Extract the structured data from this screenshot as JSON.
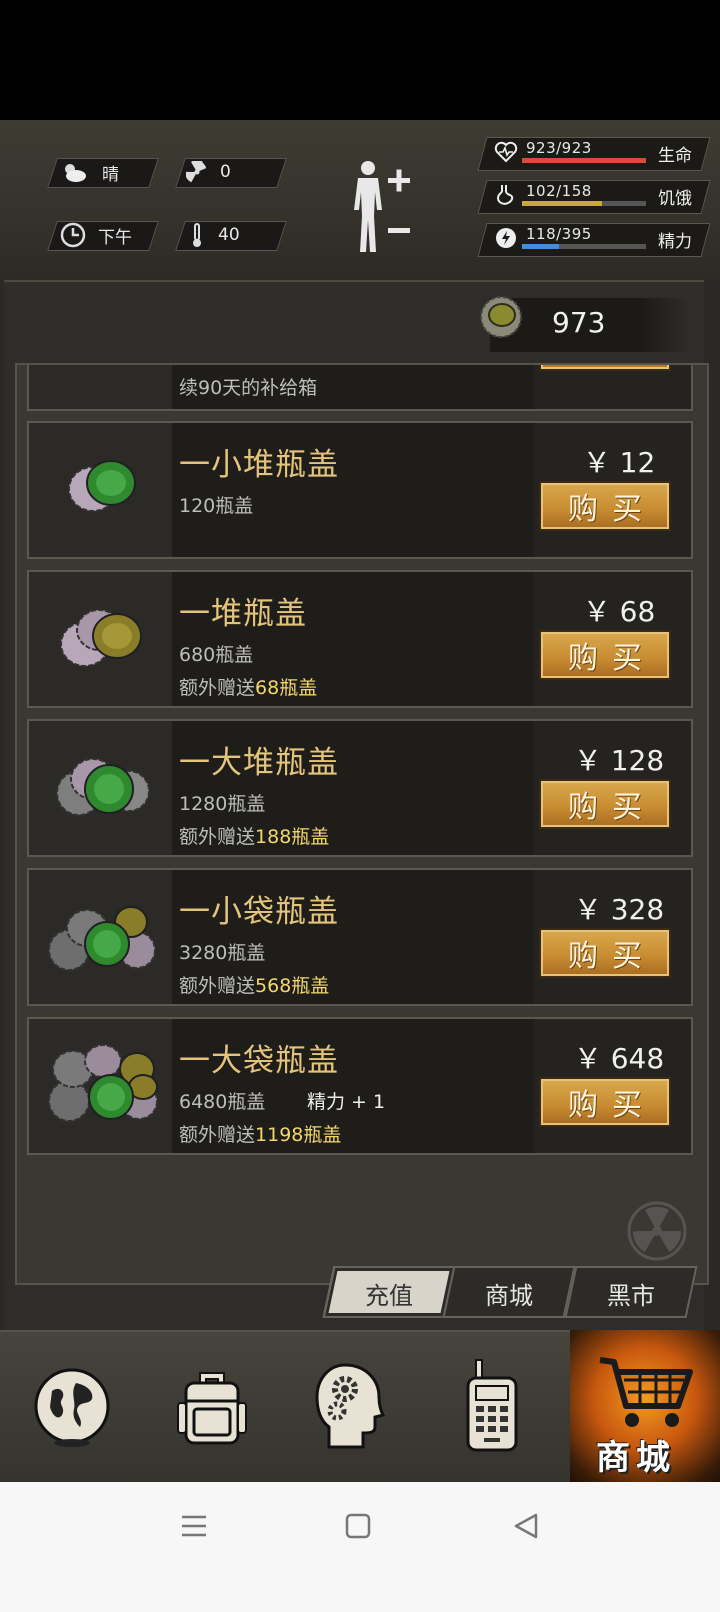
{
  "status": {
    "weather": "晴",
    "radiation": "0",
    "time_of_day": "下午",
    "temperature": "40"
  },
  "vitals": [
    {
      "label": "生命",
      "value": "923/923",
      "fill": 1.0,
      "color": "#d94a3f",
      "icon": "heart-pulse-icon"
    },
    {
      "label": "饥饿",
      "value": "102/158",
      "fill": 0.645,
      "color": "#c9a93e",
      "icon": "stomach-icon"
    },
    {
      "label": "精力",
      "value": "118/395",
      "fill": 0.299,
      "color": "#3f8fd9",
      "icon": "lightning-icon"
    }
  ],
  "currency": {
    "value": "973",
    "icon": "bottle-cap-icon"
  },
  "partial_item": {
    "title_fragment": "续90天的补给箱"
  },
  "shop_items": [
    {
      "title": "一小堆瓶盖",
      "amount": "120瓶盖",
      "bonus_prefix": "",
      "bonus_value": "",
      "extra": "",
      "price": "￥ 12",
      "buy_label": "购买"
    },
    {
      "title": "一堆瓶盖",
      "amount": "680瓶盖",
      "bonus_prefix": "额外赠送",
      "bonus_value": "68瓶盖",
      "extra": "",
      "price": "￥ 68",
      "buy_label": "购买"
    },
    {
      "title": "一大堆瓶盖",
      "amount": "1280瓶盖",
      "bonus_prefix": "额外赠送",
      "bonus_value": "188瓶盖",
      "extra": "",
      "price": "￥ 128",
      "buy_label": "购买"
    },
    {
      "title": "一小袋瓶盖",
      "amount": "3280瓶盖",
      "bonus_prefix": "额外赠送",
      "bonus_value": "568瓶盖",
      "extra": "",
      "price": "￥ 328",
      "buy_label": "购买"
    },
    {
      "title": "一大袋瓶盖",
      "amount": "6480瓶盖",
      "bonus_prefix": "额外赠送",
      "bonus_value": "1198瓶盖",
      "extra": "精力 + 1",
      "price": "￥ 648",
      "buy_label": "购买"
    }
  ],
  "tabs": [
    {
      "label": "充值",
      "active": true
    },
    {
      "label": "商城",
      "active": false
    },
    {
      "label": "黑市",
      "active": false
    }
  ],
  "bottom_nav": [
    {
      "name": "globe-icon"
    },
    {
      "name": "backpack-icon"
    },
    {
      "name": "head-gears-icon"
    },
    {
      "name": "radio-icon"
    },
    {
      "name": "shop-cart-icon",
      "label": "商城"
    }
  ]
}
